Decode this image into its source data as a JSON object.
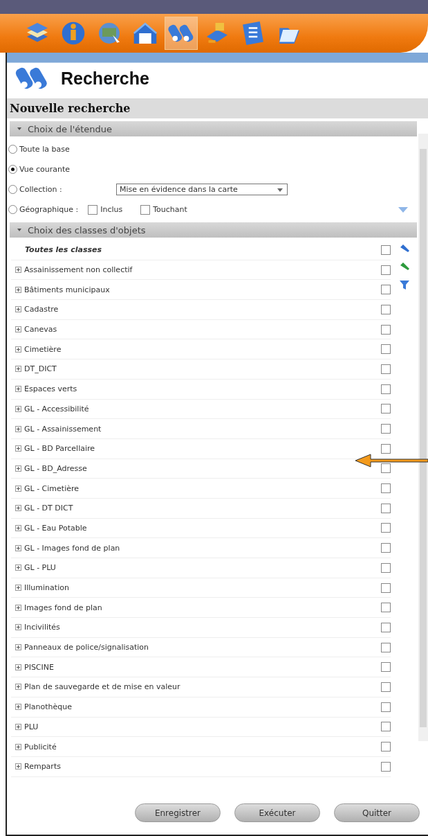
{
  "toolbar": [
    {
      "selected": false
    },
    {
      "selected": false
    },
    {
      "selected": false
    },
    {
      "selected": false
    },
    {
      "selected": true
    },
    {
      "selected": false
    },
    {
      "selected": false
    },
    {
      "selected": false
    }
  ],
  "header": {
    "title": "Recherche"
  },
  "panel_title": "Nouvelle recherche",
  "scope": {
    "title": "Choix de l'étendue",
    "expanded": true,
    "options": [
      {
        "label": "Toute la base",
        "selected": false
      },
      {
        "label": "Vue courante",
        "selected": true
      },
      {
        "label": "Collection :",
        "selected": false,
        "kind": "select",
        "value": "Mise en évidence dans la carte"
      },
      {
        "label": "Géographique :",
        "selected": false,
        "kind": "checks",
        "checks": [
          {
            "label": "Inclus",
            "checked": false
          },
          {
            "label": "Touchant",
            "checked": false
          }
        ]
      }
    ]
  },
  "classes": {
    "title": "Choix des classes d'objets",
    "expanded": true,
    "all": {
      "label": "Toutes les classes",
      "checked": false
    },
    "items": [
      {
        "label": "Assainissement non collectif",
        "checked": false
      },
      {
        "label": "Bâtiments municipaux",
        "checked": false
      },
      {
        "label": "Cadastre",
        "checked": false
      },
      {
        "label": "Canevas",
        "checked": false
      },
      {
        "label": "Cimetière",
        "checked": false
      },
      {
        "label": "DT_DICT",
        "checked": false
      },
      {
        "label": "Espaces verts",
        "checked": false
      },
      {
        "label": "GL - Accessibilité",
        "checked": false
      },
      {
        "label": "GL - Assainissement",
        "checked": false
      },
      {
        "label": "GL - BD Parcellaire",
        "checked": false
      },
      {
        "label": "GL - BD_Adresse",
        "checked": false
      },
      {
        "label": "GL - Cimetière",
        "checked": false
      },
      {
        "label": "GL - DT DICT",
        "checked": false
      },
      {
        "label": "GL - Eau Potable",
        "checked": false
      },
      {
        "label": "GL - Images fond de plan",
        "checked": false
      },
      {
        "label": "GL - PLU",
        "checked": false
      },
      {
        "label": "Illumination",
        "checked": false
      },
      {
        "label": "Images fond de plan",
        "checked": false
      },
      {
        "label": "Incivilités",
        "checked": false
      },
      {
        "label": "Panneaux de police/signalisation",
        "checked": false
      },
      {
        "label": "PISCINE",
        "checked": false
      },
      {
        "label": "Plan de sauvegarde et de mise en valeur",
        "checked": false
      },
      {
        "label": "Planothèque",
        "checked": false
      },
      {
        "label": "PLU",
        "checked": false
      },
      {
        "label": "Publicité",
        "checked": false
      },
      {
        "label": "Remparts",
        "checked": false
      }
    ]
  },
  "buttons": [
    "Enregistrer",
    "Exécuter",
    "Quitter"
  ]
}
